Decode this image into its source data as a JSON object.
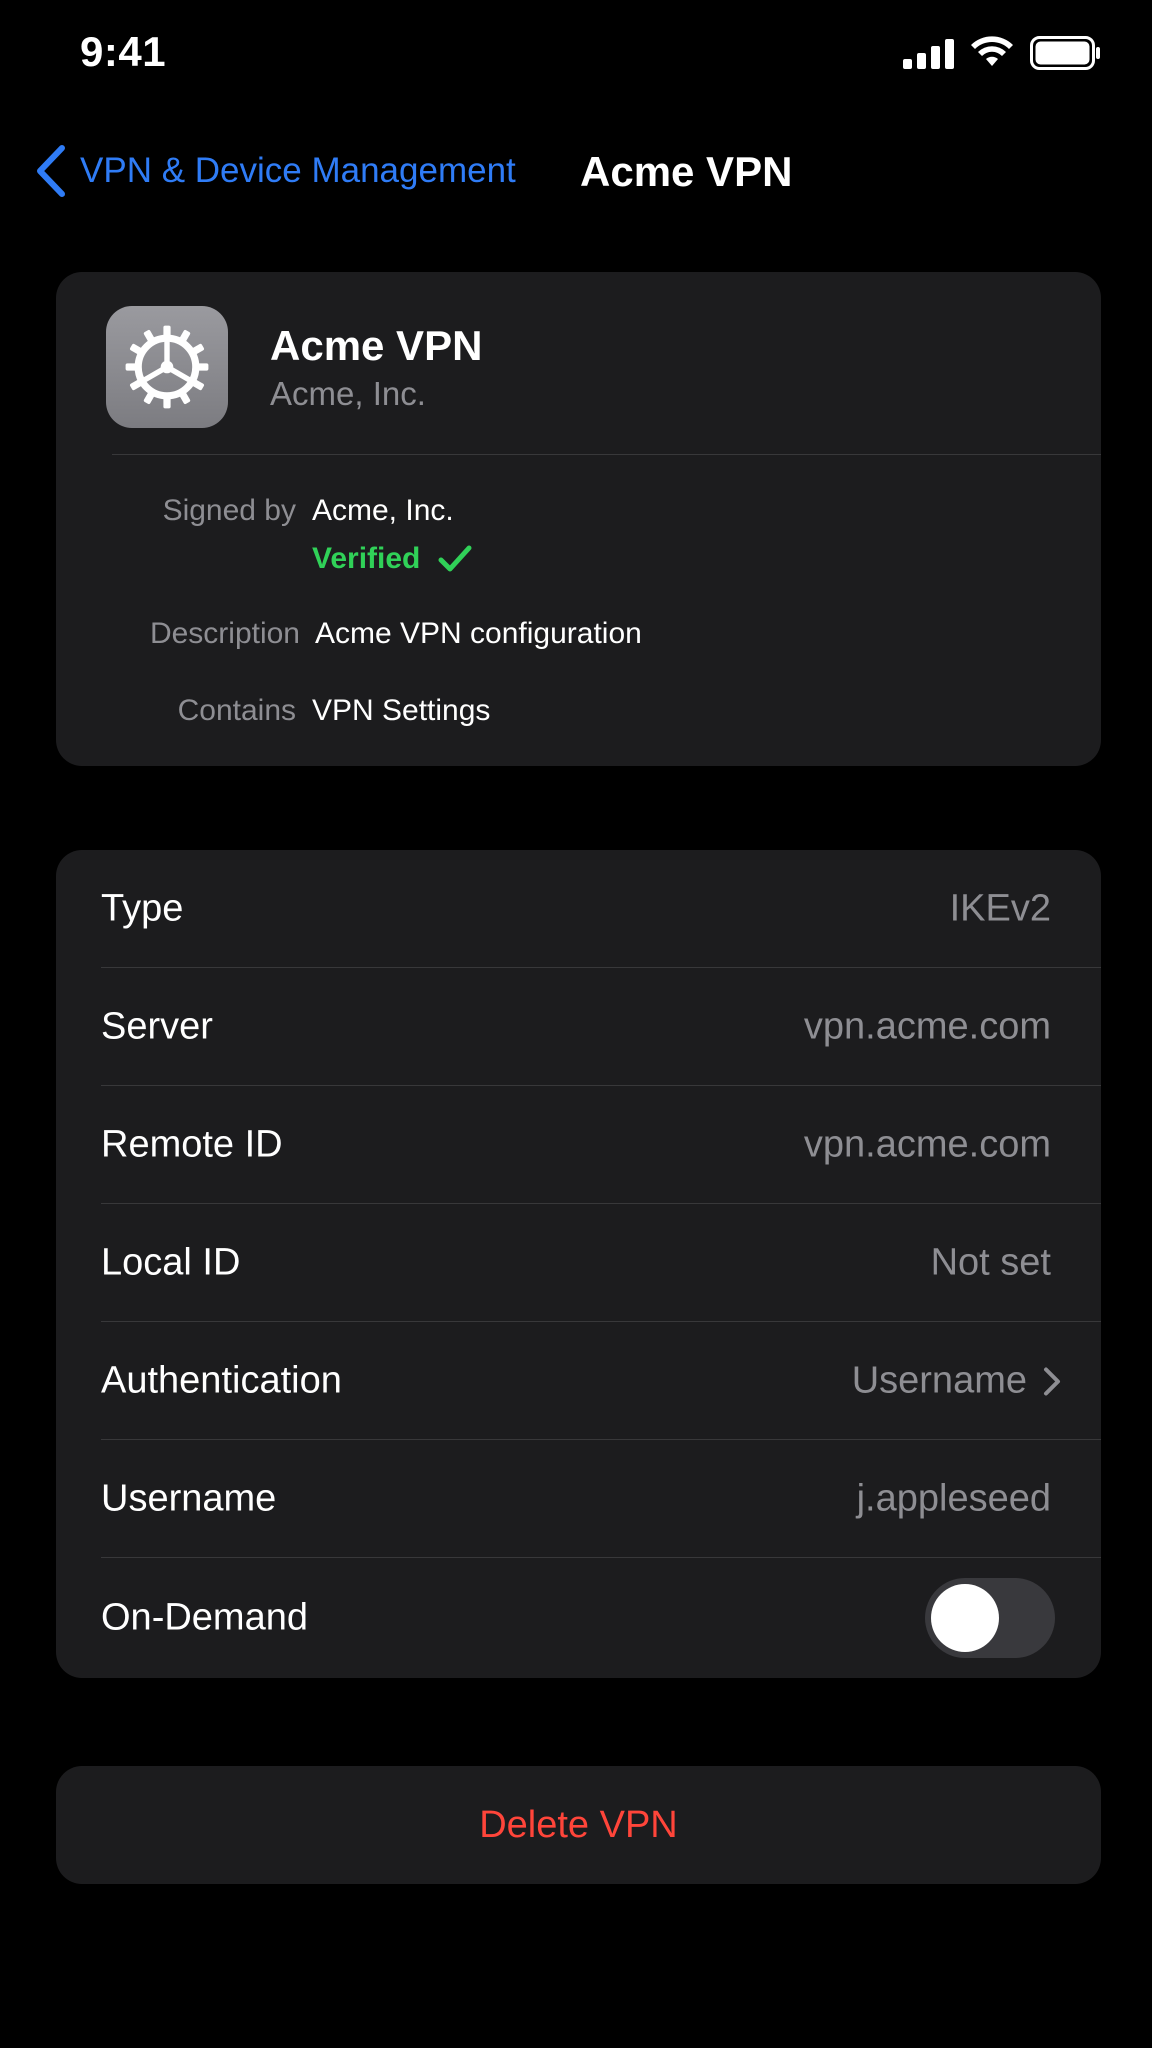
{
  "status_bar": {
    "time": "9:41",
    "icons": [
      "cellular-signal-icon",
      "wifi-icon",
      "battery-icon"
    ]
  },
  "nav": {
    "back_label": "VPN & Device Management",
    "title": "Acme VPN"
  },
  "profile": {
    "name": "Acme VPN",
    "organization": "Acme, Inc.",
    "icon": "gear-icon",
    "signed_by_label": "Signed by",
    "signed_by_value": "Acme, Inc.",
    "verified_label": "Verified",
    "description_label": "Description",
    "description_value": "Acme VPN configuration",
    "contains_label": "Contains",
    "contains_value": "VPN Settings"
  },
  "settings": {
    "rows": [
      {
        "label": "Type",
        "value": "IKEv2"
      },
      {
        "label": "Server",
        "value": "vpn.acme.com"
      },
      {
        "label": "Remote ID",
        "value": "vpn.acme.com"
      },
      {
        "label": "Local ID",
        "value": "Not set"
      },
      {
        "label": "Authentication",
        "value": "Username"
      },
      {
        "label": "Username",
        "value": "j.appleseed"
      },
      {
        "label": "On-Demand",
        "value": ""
      }
    ],
    "on_demand_enabled": false
  },
  "delete_label": "Delete VPN",
  "colors": {
    "background": "#000000",
    "card": "#1c1c1e",
    "accent_blue": "#2f7cf6",
    "verified_green": "#30d158",
    "destructive_red": "#ff453a",
    "secondary_text": "#8e8e93"
  }
}
